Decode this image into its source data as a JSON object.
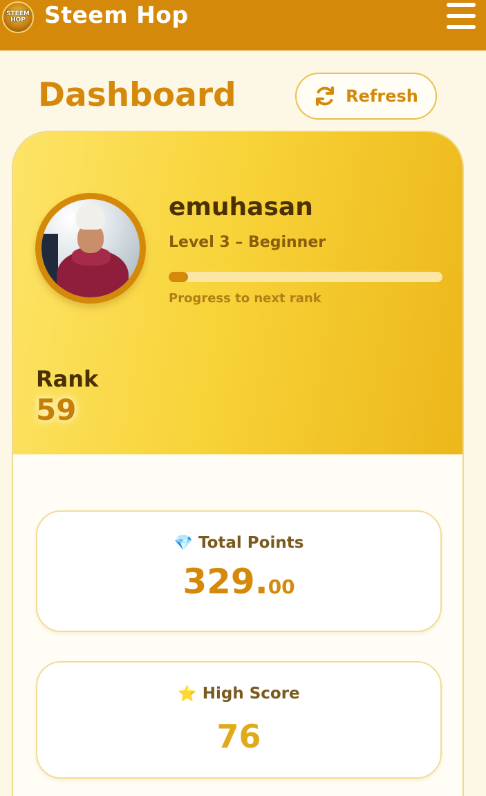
{
  "header": {
    "logo_text": "STEEM HOP",
    "app_title": "Steem Hop",
    "menu_icon": "hamburger-menu-icon"
  },
  "page": {
    "title": "Dashboard",
    "refresh_label": "Refresh",
    "refresh_icon": "sync-icon"
  },
  "profile": {
    "username": "emuhasan",
    "level_text": "Level 3 – Beginner",
    "progress_fraction": 0.07,
    "progress_caption": "Progress to next rank",
    "rank_label": "Rank",
    "rank_value": "59"
  },
  "stats": {
    "total_points": {
      "icon": "💎",
      "label": "Total Points",
      "integer": "329.",
      "decimal": "00"
    },
    "high_score": {
      "icon": "⭐",
      "label": "High Score",
      "value": "76"
    }
  },
  "colors": {
    "brand": "#d4890a",
    "background": "#fdf7e6",
    "hero_start": "#fde468",
    "hero_end": "#ecb71a"
  }
}
